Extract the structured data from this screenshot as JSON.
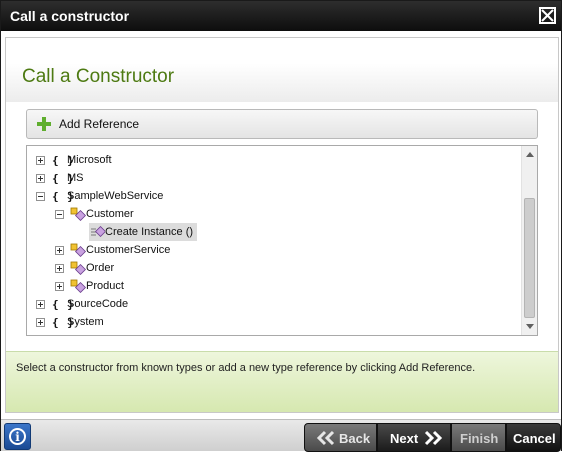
{
  "window": {
    "title": "Call a constructor"
  },
  "page": {
    "title": "Call a Constructor"
  },
  "toolbar": {
    "add_reference_label": "Add Reference"
  },
  "tree": {
    "nodes": [
      {
        "label": "Microsoft",
        "type": "namespace",
        "state": "collapsed"
      },
      {
        "label": "MS",
        "type": "namespace",
        "state": "collapsed"
      },
      {
        "label": "SampleWebService",
        "type": "namespace",
        "state": "expanded"
      },
      {
        "label": "Customer",
        "type": "class",
        "state": "expanded"
      },
      {
        "label": "Create Instance ()",
        "type": "constructor",
        "selected": true
      },
      {
        "label": "CustomerService",
        "type": "class",
        "state": "collapsed"
      },
      {
        "label": "Order",
        "type": "class",
        "state": "collapsed"
      },
      {
        "label": "Product",
        "type": "class",
        "state": "collapsed"
      },
      {
        "label": "SourceCode",
        "type": "namespace",
        "state": "collapsed"
      },
      {
        "label": "System",
        "type": "namespace",
        "state": "collapsed"
      }
    ],
    "namespace_glyph": "{ }"
  },
  "hint": {
    "text": "Select a constructor from known types or add a new type reference by clicking Add Reference."
  },
  "footer": {
    "info_glyph": "i",
    "back_label": "Back",
    "next_label": "Next",
    "finish_label": "Finish",
    "cancel_label": "Cancel"
  },
  "colors": {
    "title_green": "#4d7a12",
    "hint_bg": "#d6e8b0",
    "add_icon": "#5fae2e"
  }
}
